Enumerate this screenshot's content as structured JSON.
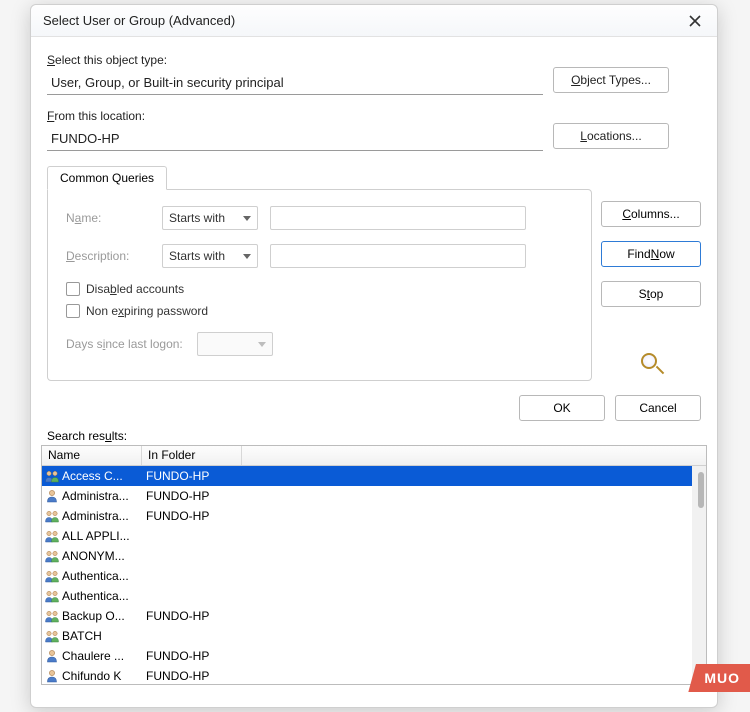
{
  "title": "Select User or Group (Advanced)",
  "labels": {
    "object_type": "Select this object type:",
    "from_location": "From this location:",
    "tab": "Common Queries",
    "name": "Name:",
    "description": "Description:",
    "disabled_accounts": "Disabled accounts",
    "non_expiring": "Non expiring password",
    "days_since_logon": "Days since last logon:",
    "search_results": "Search results:",
    "col_name": "Name",
    "col_folder": "In Folder"
  },
  "fields": {
    "object_type": "User, Group, or Built-in security principal",
    "from_location": "FUNDO-HP",
    "name_mode": "Starts with",
    "name_value": "",
    "desc_mode": "Starts with",
    "desc_value": "",
    "disabled_accounts_checked": false,
    "non_expiring_checked": false,
    "days_since_logon": ""
  },
  "buttons": {
    "object_types": "Object Types...",
    "locations": "Locations...",
    "columns": "Columns...",
    "find_now": "Find Now",
    "stop": "Stop",
    "ok": "OK",
    "cancel": "Cancel"
  },
  "results": [
    {
      "icon": "group",
      "name": "Access C...",
      "folder": "FUNDO-HP",
      "selected": true
    },
    {
      "icon": "person",
      "name": "Administra...",
      "folder": "FUNDO-HP"
    },
    {
      "icon": "group",
      "name": "Administra...",
      "folder": "FUNDO-HP"
    },
    {
      "icon": "group",
      "name": "ALL APPLI...",
      "folder": ""
    },
    {
      "icon": "group",
      "name": "ANONYM...",
      "folder": ""
    },
    {
      "icon": "group",
      "name": "Authentica...",
      "folder": ""
    },
    {
      "icon": "group",
      "name": "Authentica...",
      "folder": ""
    },
    {
      "icon": "group",
      "name": "Backup O...",
      "folder": "FUNDO-HP"
    },
    {
      "icon": "group",
      "name": "BATCH",
      "folder": ""
    },
    {
      "icon": "person",
      "name": "Chaulere ...",
      "folder": "FUNDO-HP"
    },
    {
      "icon": "person",
      "name": "Chifundo K",
      "folder": "FUNDO-HP"
    }
  ],
  "badge": "MUO"
}
